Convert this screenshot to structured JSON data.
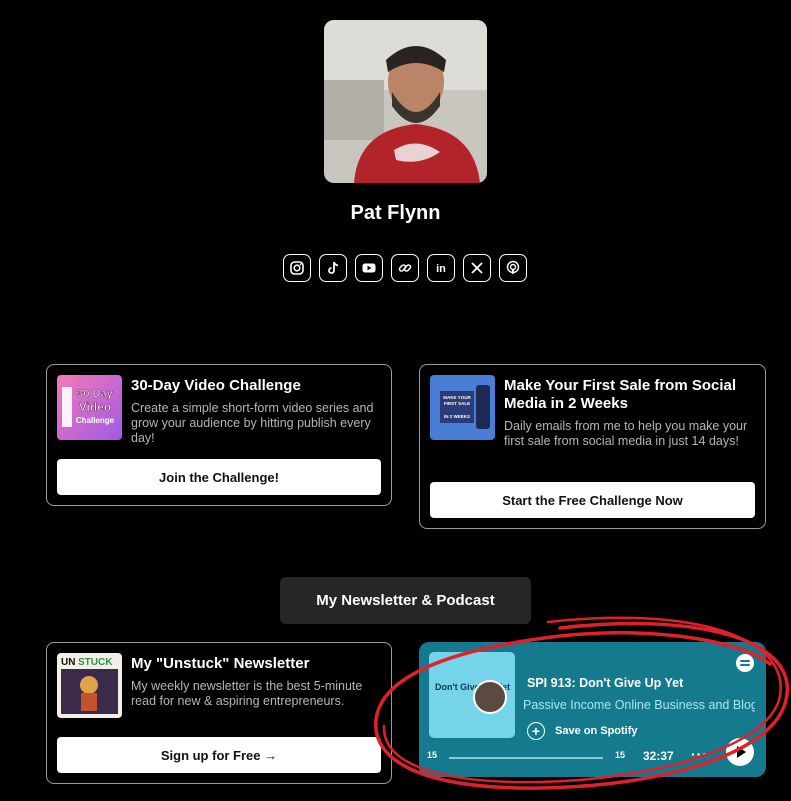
{
  "profile": {
    "name": "Pat Flynn"
  },
  "socials": [
    "instagram-icon",
    "tiktok-icon",
    "youtube-icon",
    "link-icon",
    "linkedin-icon",
    "x-icon",
    "podcast-icon"
  ],
  "cards": [
    {
      "title": "30-Day Video Challenge",
      "description": "Create a simple short-form video series and grow your audience by hitting publish every day!",
      "button": "Join the Challenge!",
      "thumb_text": "30 Day Video Challenge"
    },
    {
      "title": "Make Your First Sale from Social Media in 2 Weeks",
      "description": "Daily emails from me to help you make your first sale from social media in just 14 days!",
      "button": "Start the Free Challenge Now",
      "thumb_text": "MAKE YOUR FIRST SALE IN 2 WEEKS"
    },
    {
      "title": "My \"Unstuck\" Newsletter",
      "description": "My weekly newsletter is the best 5-minute read for new & aspiring entrepreneurs.",
      "button": "Sign up for Free →",
      "thumb_text": "UNSTUCK"
    }
  ],
  "section": {
    "title": "My Newsletter & Podcast"
  },
  "spotify": {
    "art_title": "Don't Give Up Yet",
    "episode": "SPI 913: Don't Give Up Yet",
    "show": "Passive Income Online Business and Blogging",
    "save_label": "Save on Spotify",
    "time": "32:37",
    "skip_back": "15",
    "skip_fwd": "15",
    "more": "···",
    "progress": 0.0
  },
  "colors": {
    "background": "#000000",
    "spotify_bg": "#157a8d",
    "annotation": "#e0202a"
  }
}
